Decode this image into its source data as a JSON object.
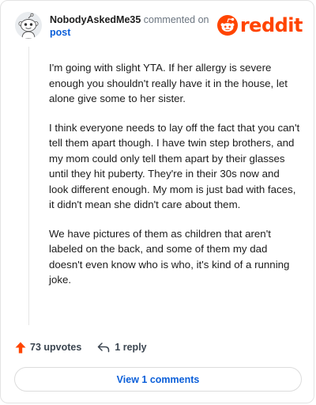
{
  "header": {
    "username": "NobodyAskedMe35",
    "commented_on": "commented on",
    "post_link": "post",
    "brand_name": "reddit",
    "brand_color": "#ff4500",
    "avatar_icon": "snoo-avatar-icon"
  },
  "comment": {
    "paragraphs": [
      "I'm going with slight YTA. If her allergy is severe enough you shouldn't really have it in the house, let alone give some to her sister.",
      "I think everyone needs to lay off the fact that you can't tell them apart though. I have twin step brothers, and my mom could only tell them apart by their glasses until they hit puberty. They're in their 30s now and look different enough. My mom is just bad with faces, it didn't mean she didn't care about them.",
      "We have pictures of them as children that aren't labeled on the back, and some of them my dad doesn't even know who is who, it's kind of a running joke."
    ]
  },
  "actions": {
    "upvotes_label": "73 upvotes",
    "reply_label": "1 reply",
    "upvote_icon": "upvote-arrow-icon",
    "reply_icon": "reply-arrow-icon",
    "upvote_color": "#ff4500"
  },
  "footer": {
    "view_comments_label": "View 1 comments",
    "link_color": "#0b5fd9"
  }
}
